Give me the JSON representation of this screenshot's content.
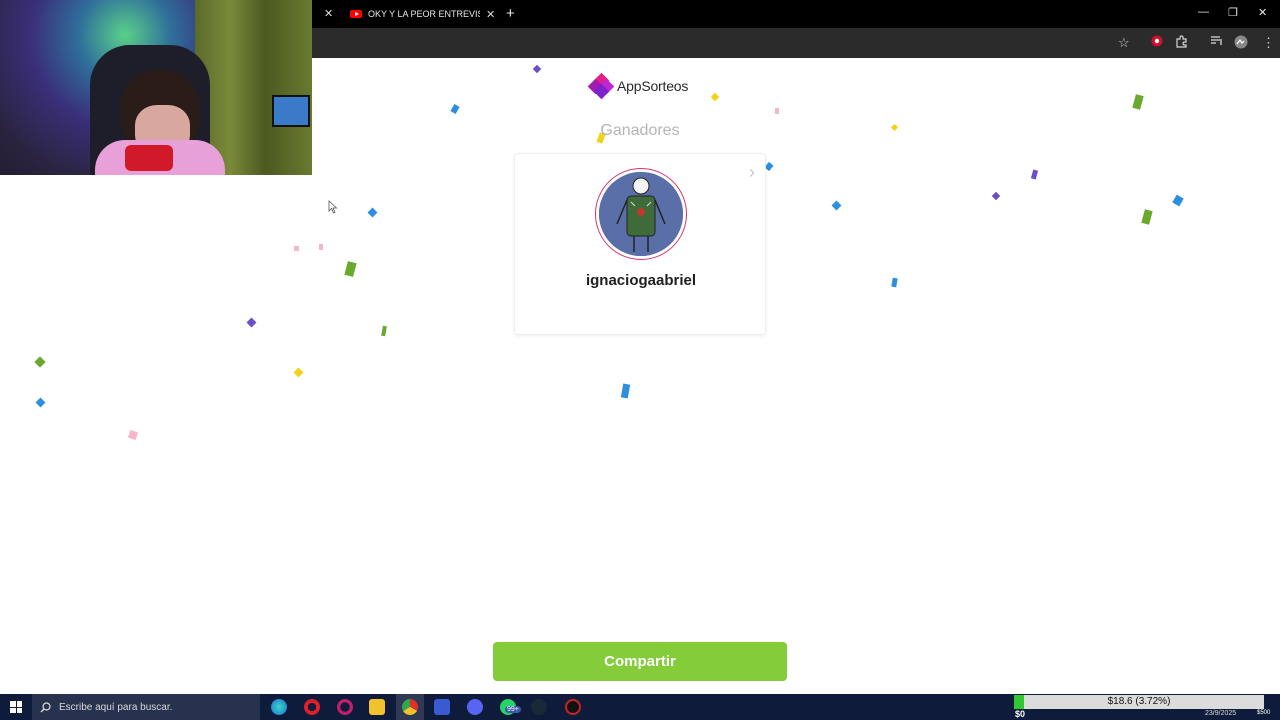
{
  "browser": {
    "tab_title": "OKY Y LA PEOR ENTREVISTA DE",
    "tab_close": "✕",
    "new_tab": "+",
    "window_controls": [
      "—",
      "❐",
      "✕"
    ]
  },
  "app": {
    "logo_text_prefix": "App",
    "logo_text_suffix": "Sorteos",
    "brand_colors": [
      "#e0218a",
      "#a21caf",
      "#7e22ce"
    ]
  },
  "winners": {
    "section_title": "Ganadores",
    "next_icon": "›",
    "items": [
      {
        "username": "ignaciogaabriel",
        "avatar": "stick-figure-avatar-icon"
      }
    ]
  },
  "actions": {
    "share_label": "Compartir",
    "share_color": "#84cc3a"
  },
  "taskbar": {
    "search_placeholder": "Escribe aquí para buscar.",
    "whatsapp_badge": "99+",
    "progress_label": "$18.6 (3.72%)",
    "progress_percent": 3.72,
    "progress_start": "$0",
    "progress_end": "$500",
    "date": "23/9/2025"
  }
}
